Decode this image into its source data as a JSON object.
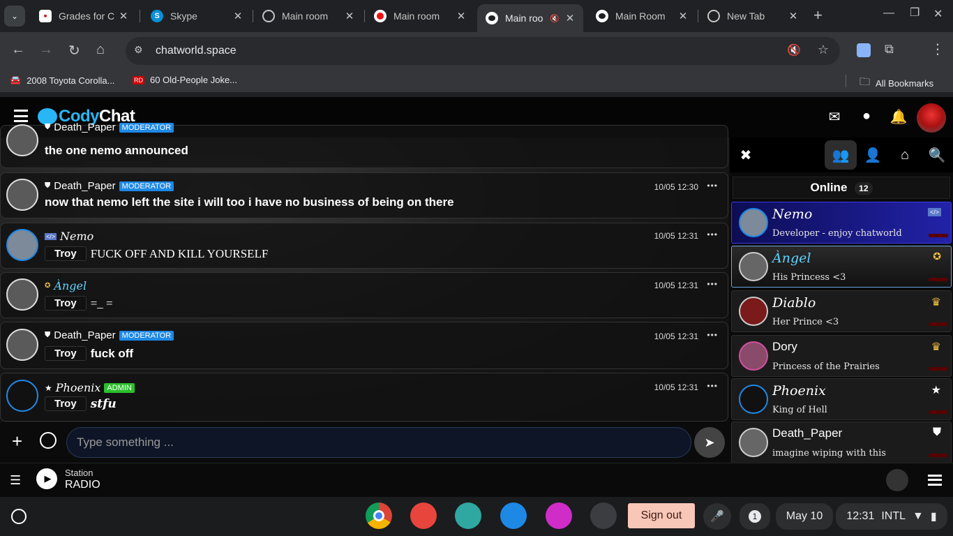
{
  "browser": {
    "tabs": [
      {
        "title": "Grades for C",
        "active": false
      },
      {
        "title": "Skype",
        "active": false
      },
      {
        "title": "Main room",
        "active": false
      },
      {
        "title": "Main room",
        "active": false
      },
      {
        "title": "Main roo",
        "active": true
      },
      {
        "title": "Main Room",
        "active": false
      },
      {
        "title": "New Tab",
        "active": false
      }
    ],
    "url": "chatworld.space",
    "bookmarks": [
      {
        "label": "2008 Toyota Corolla..."
      },
      {
        "label": "60 Old-People Joke..."
      }
    ],
    "all_bookmarks": "All Bookmarks"
  },
  "site": {
    "logo_part1": "Cody",
    "logo_part2": "Chat"
  },
  "messages": [
    {
      "user": "Death_Paper",
      "badge": "MODERATOR",
      "time": "",
      "text": "the one nemo announced"
    },
    {
      "user": "Death_Paper",
      "badge": "MODERATOR",
      "time": "10/05 12:30",
      "text": "now that nemo left the site i will too i have no business of being on there"
    },
    {
      "user": "Nemo",
      "badge": "",
      "time": "10/05 12:31",
      "tag": "Troy",
      "text": "FUCK OFF AND KILL YOURSELF"
    },
    {
      "user": "Àngel",
      "badge": "",
      "time": "10/05 12:31",
      "tag": "Troy",
      "text": "=_ ="
    },
    {
      "user": "Death_Paper",
      "badge": "MODERATOR",
      "time": "10/05 12:31",
      "tag": "Troy",
      "text": "fuck off"
    },
    {
      "user": "Phoenix",
      "badge": "ADMIN",
      "time": "10/05 12:31",
      "tag": "Troy",
      "text": "stfu"
    }
  ],
  "input": {
    "placeholder": "Type something ..."
  },
  "sidebar": {
    "online_label": "Online",
    "online_count": "12",
    "users": [
      {
        "name": "Nemo",
        "mood": "Developer - enjoy chatworld",
        "rank_icon": "code-icon"
      },
      {
        "name": "Àngel",
        "mood": "His Princess <3",
        "rank_icon": "vip-icon"
      },
      {
        "name": "Diablo",
        "mood": "Her Prince <3",
        "rank_icon": "crown-icon"
      },
      {
        "name": "Dory",
        "mood": "Princess of the Prairies",
        "rank_icon": "crown-icon"
      },
      {
        "name": "Phoenix",
        "mood": "King of Hell",
        "rank_icon": "star-icon"
      },
      {
        "name": "Death_Paper",
        "mood": "imagine wiping with this",
        "rank_icon": "shield-icon"
      }
    ]
  },
  "player": {
    "station_label": "Station",
    "station_name": "RADIO"
  },
  "taskbar": {
    "sign_out": "Sign out",
    "notifications": "1",
    "date": "May 10",
    "time": "12:31",
    "ime": "INTL"
  },
  "colors": {
    "accent": "#29b6f6",
    "moderator_badge": "#1e88e5",
    "admin_badge": "#2bbf2b",
    "developer_row": "#2222a8"
  }
}
